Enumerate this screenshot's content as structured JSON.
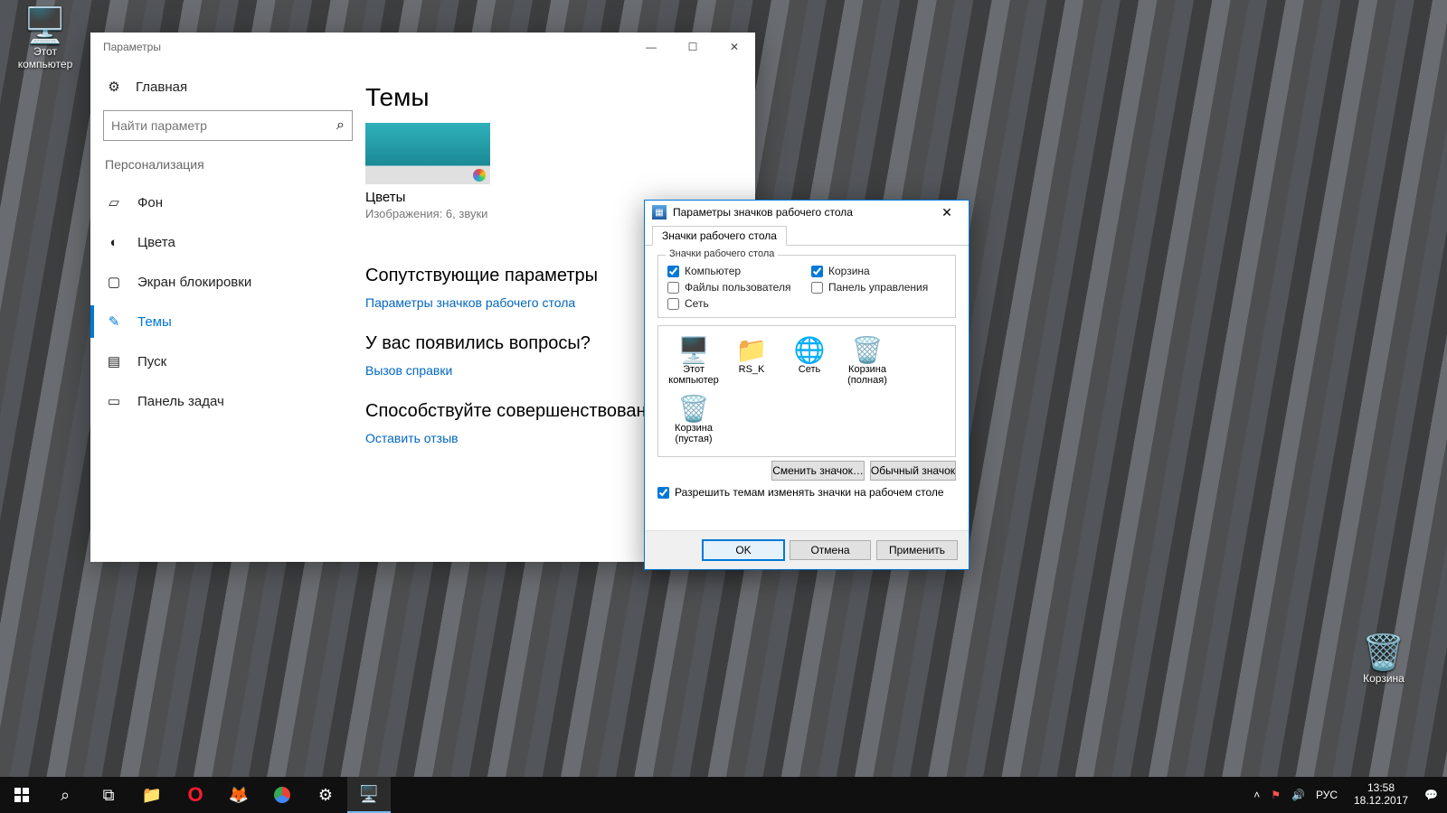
{
  "desktop": {
    "this_pc": "Этот\nкомпьютер",
    "recycle": "Корзина"
  },
  "settings": {
    "window_title": "Параметры",
    "home": "Главная",
    "search_placeholder": "Найти параметр",
    "category": "Персонализация",
    "nav": {
      "background": "Фон",
      "colors": "Цвета",
      "lockscreen": "Экран блокировки",
      "themes": "Темы",
      "start": "Пуск",
      "taskbar": "Панель задач"
    },
    "heading": "Темы",
    "theme_name": "Цветы",
    "theme_sub": "Изображения: 6, звуки",
    "related_heading": "Сопутствующие параметры",
    "related_link": "Параметры значков рабочего стола",
    "questions_heading": "У вас появились вопросы?",
    "help_link": "Вызов справки",
    "improve_heading": "Способствуйте совершенствованию…",
    "feedback_link": "Оставить отзыв"
  },
  "dialog": {
    "title": "Параметры значков рабочего стола",
    "tab": "Значки рабочего стола",
    "group_title": "Значки рабочего стола",
    "cb_computer": "Компьютер",
    "cb_recycle": "Корзина",
    "cb_userfiles": "Файлы пользователя",
    "cb_controlpanel": "Панель управления",
    "cb_network": "Сеть",
    "icon_this_pc": "Этот\nкомпьютер",
    "icon_user": "RS_K",
    "icon_network": "Сеть",
    "icon_recycle_full": "Корзина\n(полная)",
    "icon_recycle_empty": "Корзина\n(пустая)",
    "btn_change": "Сменить значок…",
    "btn_default": "Обычный значок",
    "allow_themes": "Разрешить темам изменять значки на рабочем столе",
    "ok": "OK",
    "cancel": "Отмена",
    "apply": "Применить"
  },
  "taskbar": {
    "lang": "РУС",
    "time": "13:58",
    "date": "18.12.2017"
  }
}
